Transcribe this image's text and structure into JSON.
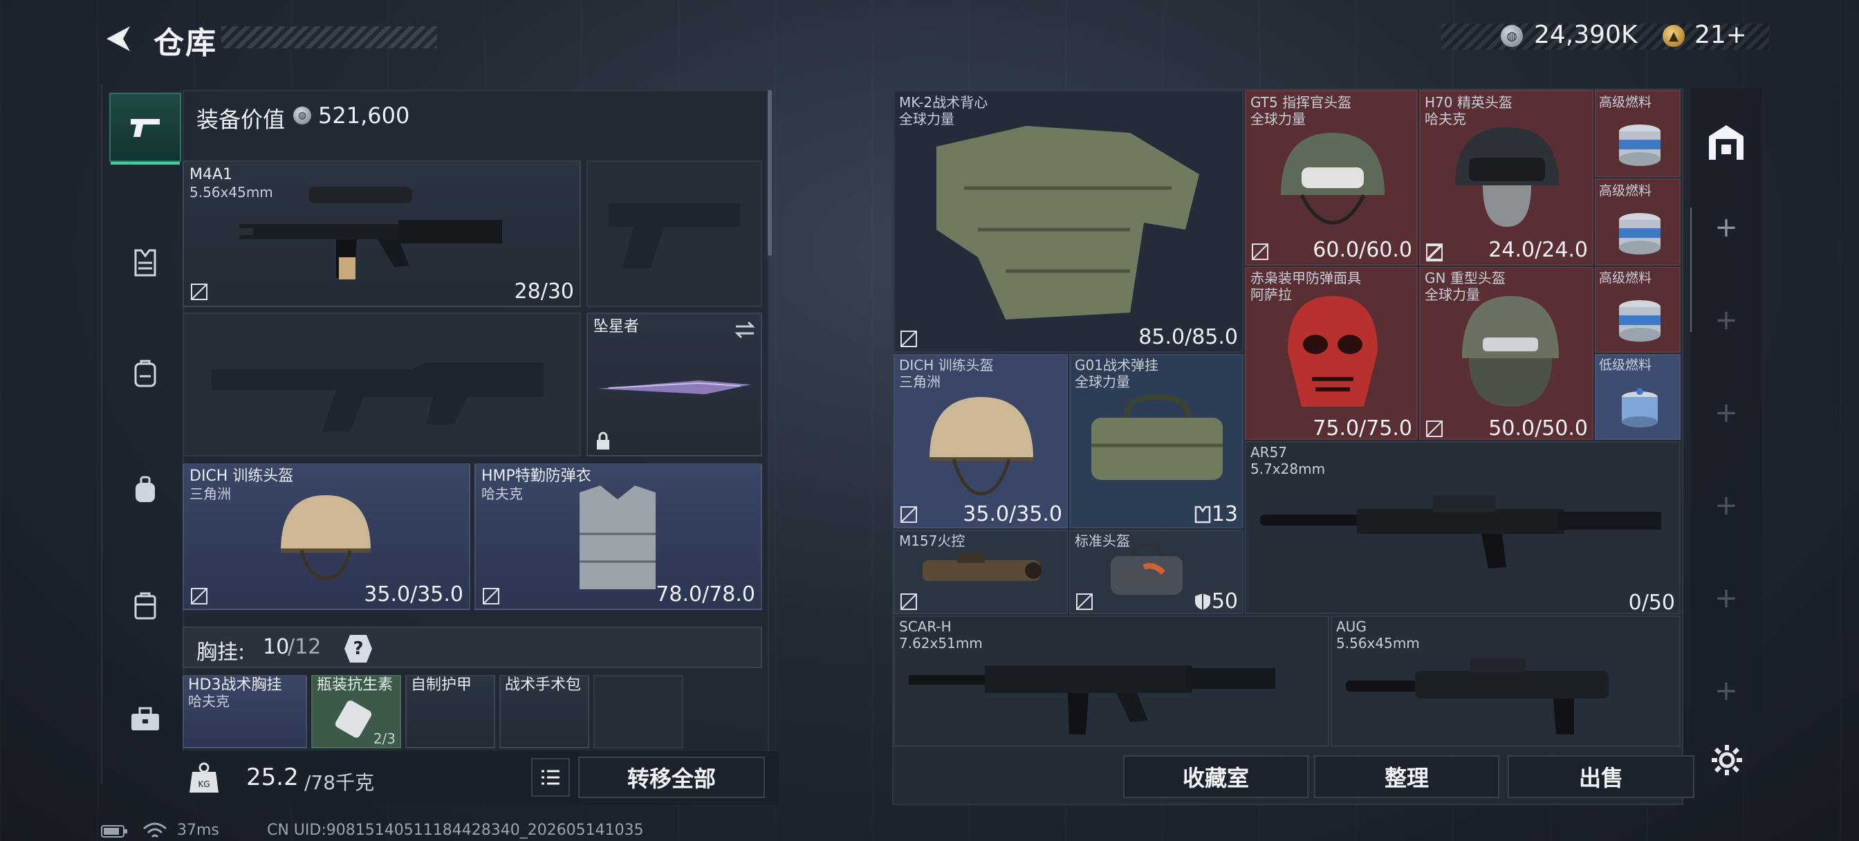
{
  "header": {
    "title": "仓库",
    "silver_amount": "24,390K",
    "gold_amount": "21+"
  },
  "left_panel": {
    "equip_value_label": "装备价值",
    "equip_value": "521,600",
    "primary_weapon": {
      "name": "M4A1",
      "caliber": "5.56x45mm",
      "ammo": "28/30"
    },
    "melee": {
      "name": "坠星者"
    },
    "helmet": {
      "name": "DICH 训练头盔",
      "maker": "三角洲",
      "durability": "35.0/35.0"
    },
    "armor": {
      "name": "HMP特勤防弹衣",
      "maker": "哈夫克",
      "durability": "78.0/78.0"
    },
    "chest_rig": {
      "label": "胸挂:",
      "count": "10",
      "capacity": "/12",
      "help": "?"
    },
    "rig_items": [
      {
        "name": "HD3战术胸挂",
        "maker": "哈夫克"
      },
      {
        "name": "瓶装抗生素",
        "count": "2/3"
      },
      {
        "name": "自制护甲"
      },
      {
        "name": "战术手术包"
      }
    ],
    "weight": {
      "current": "25.2",
      "total": "/78千克",
      "icon_label": "KG"
    },
    "transfer_all": "转移全部"
  },
  "right_panel": {
    "items": [
      {
        "name": "MK-2战术背心",
        "maker": "全球力量",
        "durability": "85.0/85.0"
      },
      {
        "name": "GT5 指挥官头盔",
        "maker": "全球力量",
        "durability": "60.0/60.0"
      },
      {
        "name": "H70 精英头盔",
        "maker": "哈夫克",
        "durability": "24.0/24.0"
      },
      {
        "name": "高级燃料"
      },
      {
        "name": "高级燃料"
      },
      {
        "name": "赤枭装甲防弹面具",
        "maker": "阿萨拉",
        "durability": "75.0/75.0"
      },
      {
        "name": "GN 重型头盔",
        "maker": "全球力量",
        "durability": "50.0/50.0"
      },
      {
        "name": "高级燃料"
      },
      {
        "name": "低级燃料"
      },
      {
        "name": "DICH 训练头盔",
        "maker": "三角洲",
        "durability": "35.0/35.0"
      },
      {
        "name": "G01战术弹挂",
        "maker": "全球力量",
        "count": "13"
      },
      {
        "name": "AR57",
        "caliber": "5.7x28mm",
        "ammo": "0/50"
      },
      {
        "name": "M157火控"
      },
      {
        "name": "标准头盔",
        "count": "50"
      },
      {
        "name": "SCAR-H",
        "caliber": "7.62x51mm"
      },
      {
        "name": "AUG",
        "caliber": "5.56x45mm"
      }
    ],
    "buttons": {
      "collection": "收藏室",
      "sort": "整理",
      "sell": "出售"
    }
  },
  "footer": {
    "ping": "37ms",
    "uid": "CN UID:9081514051118442834​0_202605141035"
  },
  "icons": [
    "back-arrow-icon",
    "silver-coin-icon",
    "gold-coin-icon",
    "pistol-icon",
    "vest-icon",
    "backpack-icon",
    "bag-icon",
    "case-icon",
    "toolbox-icon",
    "no-repair-icon",
    "swap-icon",
    "lock-icon",
    "list-icon",
    "weight-icon",
    "storage-icon",
    "plus-icon",
    "gear-icon",
    "battery-icon",
    "wifi-icon"
  ]
}
